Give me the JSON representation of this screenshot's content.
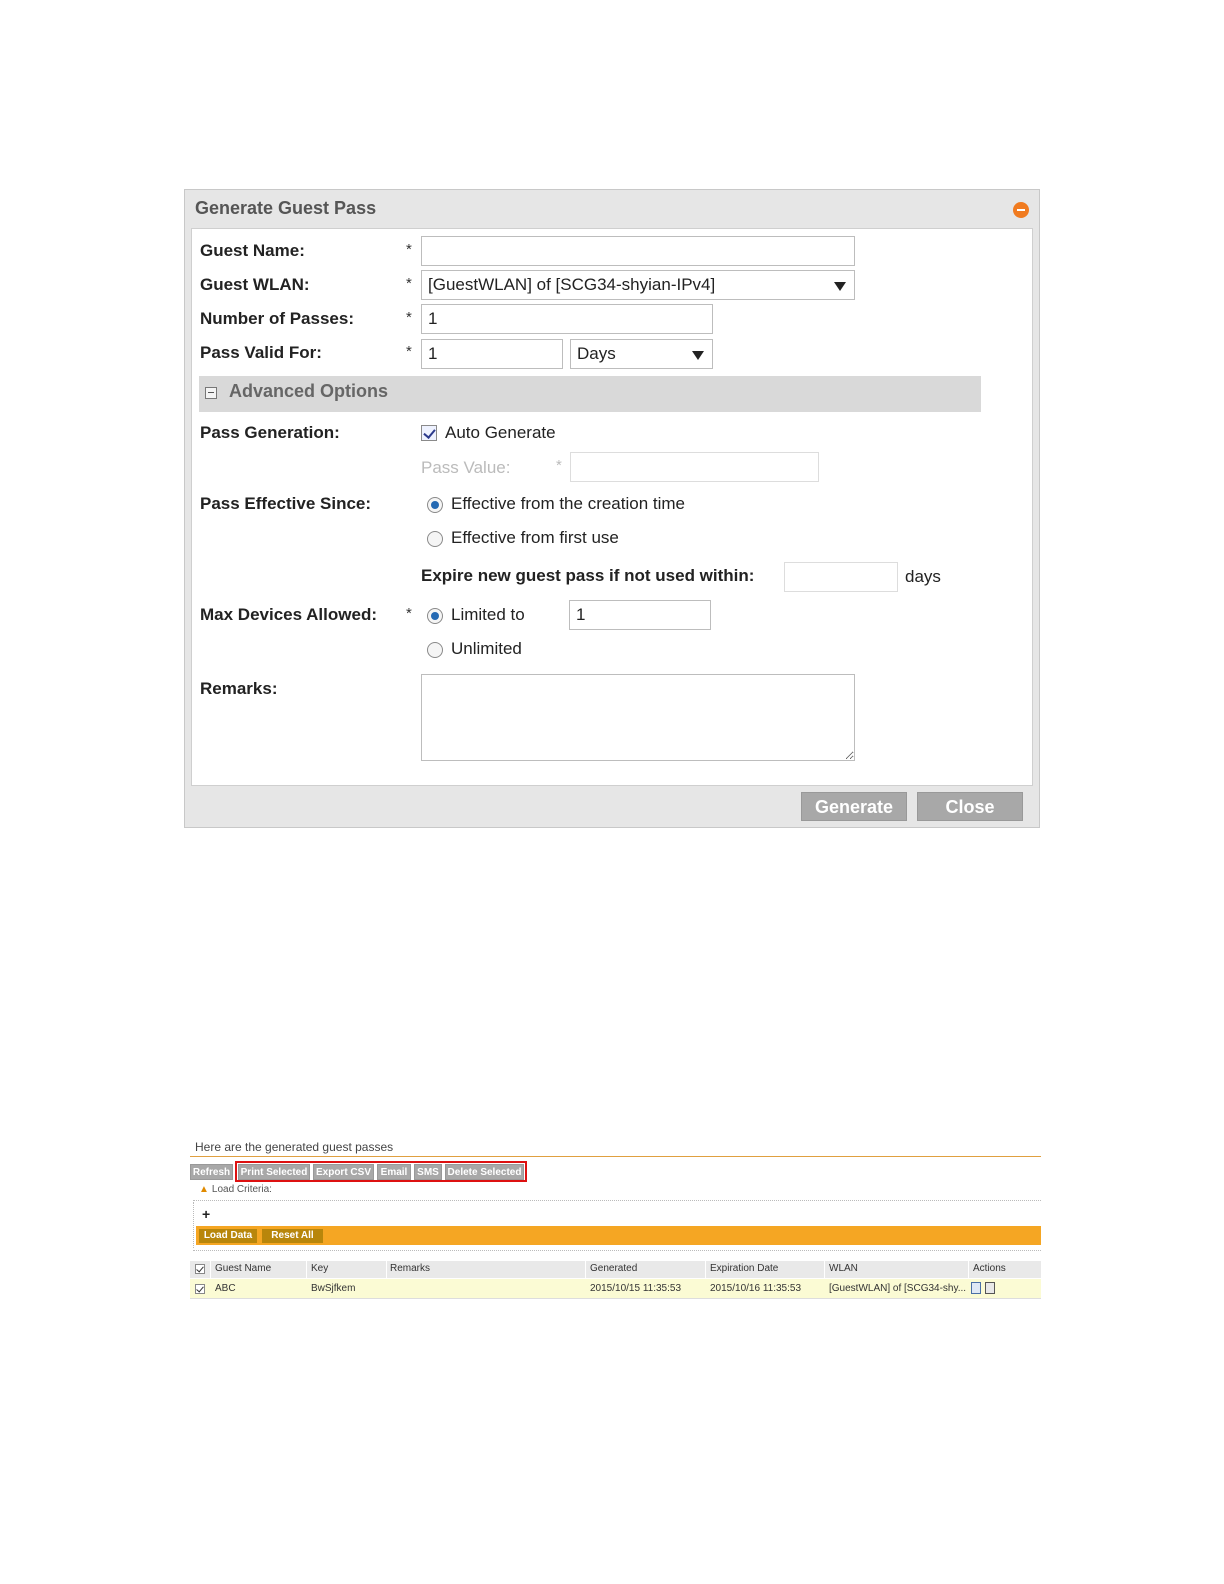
{
  "dialog": {
    "title": "Generate Guest Pass",
    "fields": {
      "guest_name_label": "Guest Name:",
      "guest_name_value": "",
      "guest_wlan_label": "Guest WLAN:",
      "guest_wlan_value": "[GuestWLAN] of [SCG34-shyian-IPv4]",
      "num_passes_label": "Number of Passes:",
      "num_passes_value": "1",
      "pass_valid_label": "Pass Valid For:",
      "pass_valid_value": "1",
      "pass_valid_unit": "Days",
      "required_mark": "*"
    },
    "advanced": {
      "header": "Advanced Options",
      "pass_generation_label": "Pass Generation:",
      "auto_generate_label": "Auto Generate",
      "auto_generate_checked": true,
      "pass_value_label": "Pass Value:",
      "pass_value": "",
      "effective_since_label": "Pass Effective Since:",
      "effective_creation": "Effective from the creation time",
      "effective_first_use": "Effective from first use",
      "effective_selected": "creation",
      "expire_label": "Expire new guest pass if not used within:",
      "expire_value": "",
      "expire_unit": "days",
      "max_devices_label": "Max Devices Allowed:",
      "limited_to_label": "Limited to",
      "limited_to_value": "1",
      "unlimited_label": "Unlimited",
      "max_devices_selected": "limited",
      "remarks_label": "Remarks:",
      "remarks_value": ""
    },
    "buttons": {
      "generate": "Generate",
      "close": "Close"
    }
  },
  "guest_list": {
    "caption": "Here are the generated guest passes",
    "toolbar": [
      "Refresh",
      "Print Selected",
      "Export CSV",
      "Email",
      "SMS",
      "Delete Selected"
    ],
    "load_criteria": "Load Criteria:",
    "add_symbol": "+",
    "load_data": "Load Data",
    "reset_all": "Reset All",
    "columns": [
      "Guest Name",
      "Key",
      "Remarks",
      "Generated",
      "Expiration Date",
      "WLAN",
      "Actions"
    ],
    "rows": [
      {
        "guest_name": "ABC",
        "key": "BwSjfkem",
        "remarks": "",
        "generated": "2015/10/15 11:35:53",
        "expiration": "2015/10/16 11:35:53",
        "wlan": "[GuestWLAN] of [SCG34-shy..."
      }
    ]
  }
}
